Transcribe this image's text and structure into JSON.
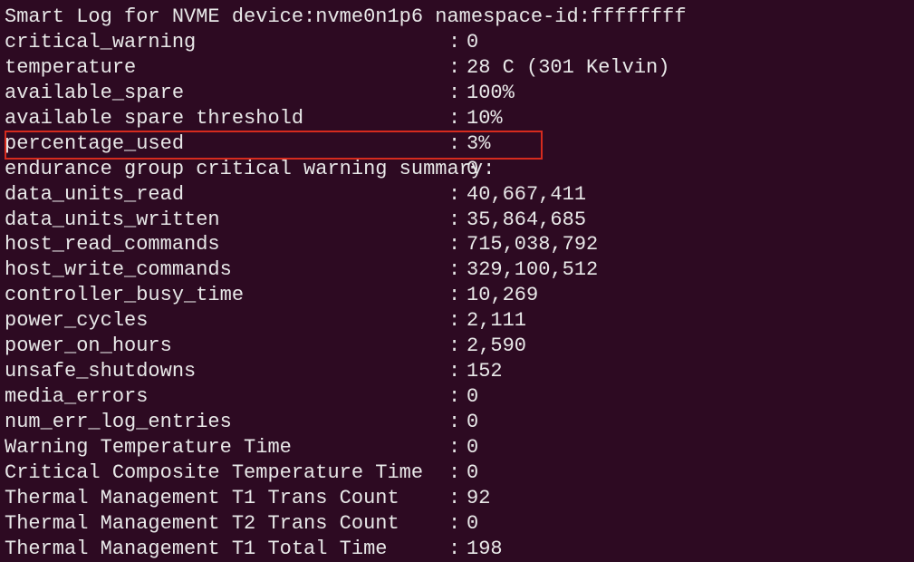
{
  "header": "Smart Log for NVME device:nvme0n1p6 namespace-id:ffffffff",
  "rows": [
    {
      "key": "critical_warning",
      "sep": ":",
      "val": "0",
      "highlight": false
    },
    {
      "key": "temperature",
      "sep": ":",
      "val": "28 C (301 Kelvin)",
      "highlight": false
    },
    {
      "key": "available_spare",
      "sep": ":",
      "val": "100%",
      "highlight": false
    },
    {
      "key": "available spare threshold",
      "sep": ":",
      "val": "10%",
      "highlight": false
    },
    {
      "key": "percentage_used",
      "sep": ":",
      "val": "3%",
      "highlight": true
    },
    {
      "key": "endurance group critical warning summary:",
      "sep": "",
      "val": "0",
      "highlight": false
    },
    {
      "key": "data_units_read",
      "sep": ":",
      "val": "40,667,411",
      "highlight": false
    },
    {
      "key": "data_units_written",
      "sep": ":",
      "val": "35,864,685",
      "highlight": false
    },
    {
      "key": "host_read_commands",
      "sep": ":",
      "val": "715,038,792",
      "highlight": false
    },
    {
      "key": "host_write_commands",
      "sep": ":",
      "val": "329,100,512",
      "highlight": false
    },
    {
      "key": "controller_busy_time",
      "sep": ":",
      "val": "10,269",
      "highlight": false
    },
    {
      "key": "power_cycles",
      "sep": ":",
      "val": "2,111",
      "highlight": false
    },
    {
      "key": "power_on_hours",
      "sep": ":",
      "val": "2,590",
      "highlight": false
    },
    {
      "key": "unsafe_shutdowns",
      "sep": ":",
      "val": "152",
      "highlight": false
    },
    {
      "key": "media_errors",
      "sep": ":",
      "val": "0",
      "highlight": false
    },
    {
      "key": "num_err_log_entries",
      "sep": ":",
      "val": "0",
      "highlight": false
    },
    {
      "key": "Warning Temperature Time",
      "sep": ":",
      "val": "0",
      "highlight": false
    },
    {
      "key": "Critical Composite Temperature Time",
      "sep": ":",
      "val": "0",
      "highlight": false
    },
    {
      "key": "Thermal Management T1 Trans Count",
      "sep": ":",
      "val": "92",
      "highlight": false
    },
    {
      "key": "Thermal Management T2 Trans Count",
      "sep": ":",
      "val": "0",
      "highlight": false
    },
    {
      "key": "Thermal Management T1 Total Time",
      "sep": ":",
      "val": "198",
      "highlight": false
    }
  ]
}
